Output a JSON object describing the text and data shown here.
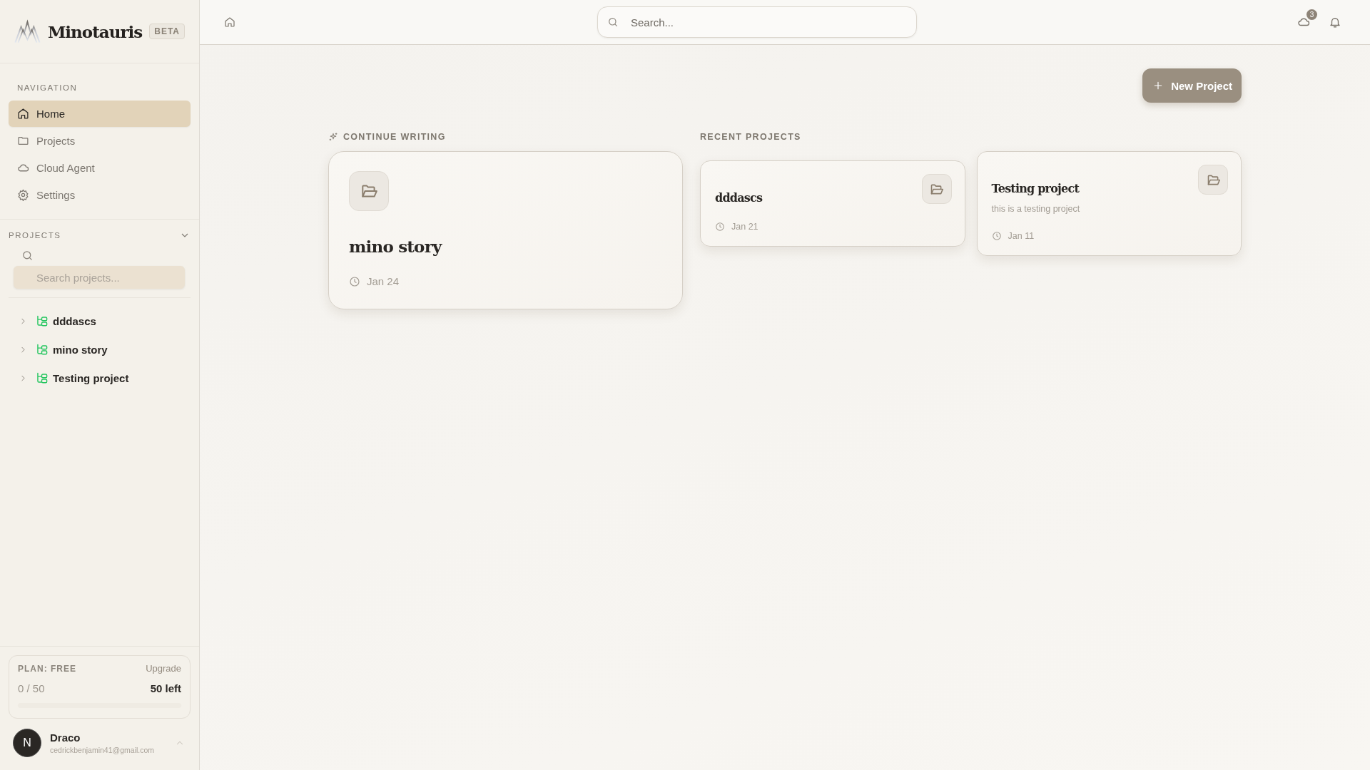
{
  "brand": {
    "name": "Minotauris",
    "badge": "BETA"
  },
  "navigation": {
    "heading": "NAVIGATION",
    "items": [
      {
        "label": "Home",
        "selected": true
      },
      {
        "label": "Projects",
        "selected": false
      },
      {
        "label": "Cloud Agent",
        "selected": false
      },
      {
        "label": "Settings",
        "selected": false
      }
    ]
  },
  "projects_panel": {
    "heading": "PROJECTS",
    "expanded": true,
    "search": {
      "placeholder": "Search projects..."
    },
    "items": [
      {
        "label": "dddascs",
        "expanded": false
      },
      {
        "label": "mino story",
        "expanded": false
      },
      {
        "label": "Testing project",
        "expanded": false
      }
    ]
  },
  "plan": {
    "label": "PLAN: FREE",
    "upgrade": "Upgrade",
    "usage": "0 / 50",
    "remaining": "50 left",
    "level": 0
  },
  "user": {
    "initial": "N",
    "name": "Draco",
    "email": "cedrickbenjamin41@gmail.com"
  },
  "topbar": {
    "search": {
      "placeholder": "Search..."
    },
    "cloud_badge": "3"
  },
  "new_project": "New Project",
  "continue_writing": {
    "heading": "CONTINUE WRITING",
    "card": {
      "title": "mino story",
      "date": "Jan 24"
    }
  },
  "recent_projects": {
    "heading": "RECENT PROJECTS",
    "cards": [
      {
        "title": "dddascs",
        "date": "Jan 21"
      },
      {
        "title": "Testing project",
        "description": "this is a testing project",
        "date": "Jan 11"
      }
    ]
  }
}
